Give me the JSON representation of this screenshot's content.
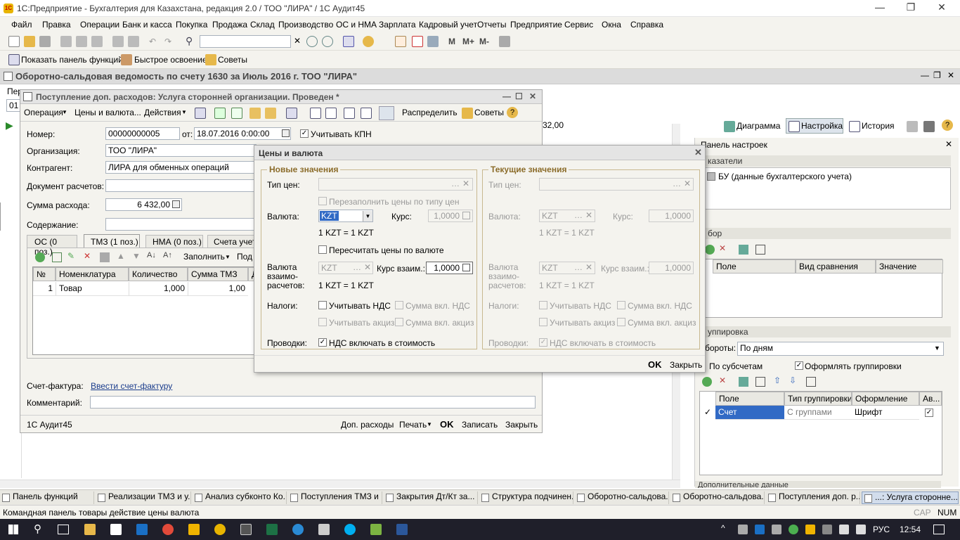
{
  "app": {
    "title": "1С:Предприятие - Бухгалтерия для Казахстана, редакция 2.0 / ТОО \"ЛИРА\" / 1С Аудит45",
    "menu": [
      "Файл",
      "Правка",
      "Операции",
      "Банк и касса",
      "Покупка",
      "Продажа",
      "Склад",
      "Производство",
      "ОС и НМА",
      "Зарплата",
      "Кадровый учет",
      "Отчеты",
      "Предприятие",
      "Сервис",
      "Окна",
      "Справка"
    ],
    "toolbar2": {
      "functions_panel": "Показать панель функций",
      "quick_start": "Быстрое освоение",
      "tips": "Советы"
    },
    "toolbar1": {
      "m": "M",
      "mplus": "M+",
      "mminus": "M-"
    }
  },
  "report": {
    "title": "Оборотно-сальдовая ведомость по счету 1630 за Июль 2016 г. ТОО \"ЛИРА\"",
    "per_label": "Пер",
    "per_value": "01",
    "amount_fragment": "32,00",
    "buttons": {
      "diagram": "Диаграмма",
      "settings": "Настройка",
      "history": "История"
    },
    "settings_panel": {
      "title": "Панель настроек",
      "indicators_head": "казатели",
      "indicator": "БУ (данные бухгалтерского учета)",
      "filter_head": "бор",
      "filter_cols": [
        "Поле",
        "Вид сравнения",
        "Значение"
      ],
      "grouping_head": "уппировка",
      "turnovers_label": "бороты:",
      "turnovers_value": "По дням",
      "by_subaccounts": "По субсчетам",
      "format_groupings": "Оформлять группировки",
      "group_cols": [
        "Поле",
        "Тип группировки",
        "Оформление",
        "Ав..."
      ],
      "group_row": [
        "Счет",
        "С группами",
        "Шрифт"
      ],
      "additional_head": "Дополнительные данные"
    }
  },
  "doc": {
    "title": "Поступление доп. расходов: Услуга сторонней организации. Проведен *",
    "toolbar": [
      "Операция",
      "Цены и валюта...",
      "Действия",
      "Распределить",
      "Советы"
    ],
    "number_label": "Номер:",
    "number": "00000000005",
    "date_label": "от:",
    "date": "18.07.2016  0:00:00",
    "kpn_label": "Учитывать КПН",
    "org_label": "Организация:",
    "org": "ТОО \"ЛИРА\"",
    "contractor_label": "Контрагент:",
    "contractor": "ЛИРА для обменных операций",
    "doc_label": "Документ расчетов:",
    "sum_label": "Сумма расхода:",
    "sum": "6 432,00",
    "content_label": "Содержание:",
    "tabs": [
      "ОС (0 поз.)",
      "ТМЗ (1 поз.)",
      "НМА (0 поз.)",
      "Счета учета"
    ],
    "fill_btn": "Заполнить",
    "sel_btn": "Под",
    "cols": [
      "№",
      "Номенклатура",
      "Количество",
      "Сумма ТМЗ",
      "Д"
    ],
    "row": [
      "1",
      "Товар",
      "1,000",
      "1,00"
    ],
    "invoice_label": "Счет-фактура:",
    "invoice_link": "Ввести счет-фактуру",
    "comment_label": "Комментарий:",
    "footer_user": "1С Аудит45",
    "footer_buttons": [
      "Доп. расходы",
      "Печать",
      "OK",
      "Записать",
      "Закрыть"
    ]
  },
  "dialog": {
    "title": "Цены и валюта",
    "new_head": "Новые значения",
    "cur_head": "Текущие значения",
    "price_type": "Тип цен:",
    "refill": "Перезаполнить цены по типу цен",
    "currency": "Валюта:",
    "currency_value": "KZT",
    "rate": "Курс:",
    "rate_value": "1,0000",
    "ratio": "1 KZT = 1 KZT",
    "recalc": "Пересчитать цены по валюте",
    "settle_currency": "Валюта\nвзаимо-\nрасчетов:",
    "settle_rate": "Курс взаим.:",
    "settle_rate_value": "1,0000",
    "taxes": "Налоги:",
    "vat": "Учитывать НДС",
    "sum_vat": "Сумма вкл. НДС",
    "excise": "Учитывать акциз",
    "sum_excise": "Сумма вкл. акциз",
    "postings": "Проводки:",
    "vat_in_cost": "НДС включать в стоимость",
    "ok": "OK",
    "close": "Закрыть"
  },
  "tabs": [
    "Панель функций",
    "Реализации ТМЗ и у...",
    "Анализ субконто Ко...",
    "Поступления ТМЗ и ...",
    "Закрытия Дт/Кт за...",
    "Структура подчинен...",
    "Оборотно-сальдова...",
    "Оборотно-сальдова...",
    "Поступления доп. р...",
    "...: Услуга сторонне..."
  ],
  "status": {
    "text": "Командная панель товары действие цены валюта",
    "cap": "CAP",
    "num": "NUM"
  },
  "taskbar": {
    "lang": "РУС",
    "time": "12:54"
  }
}
